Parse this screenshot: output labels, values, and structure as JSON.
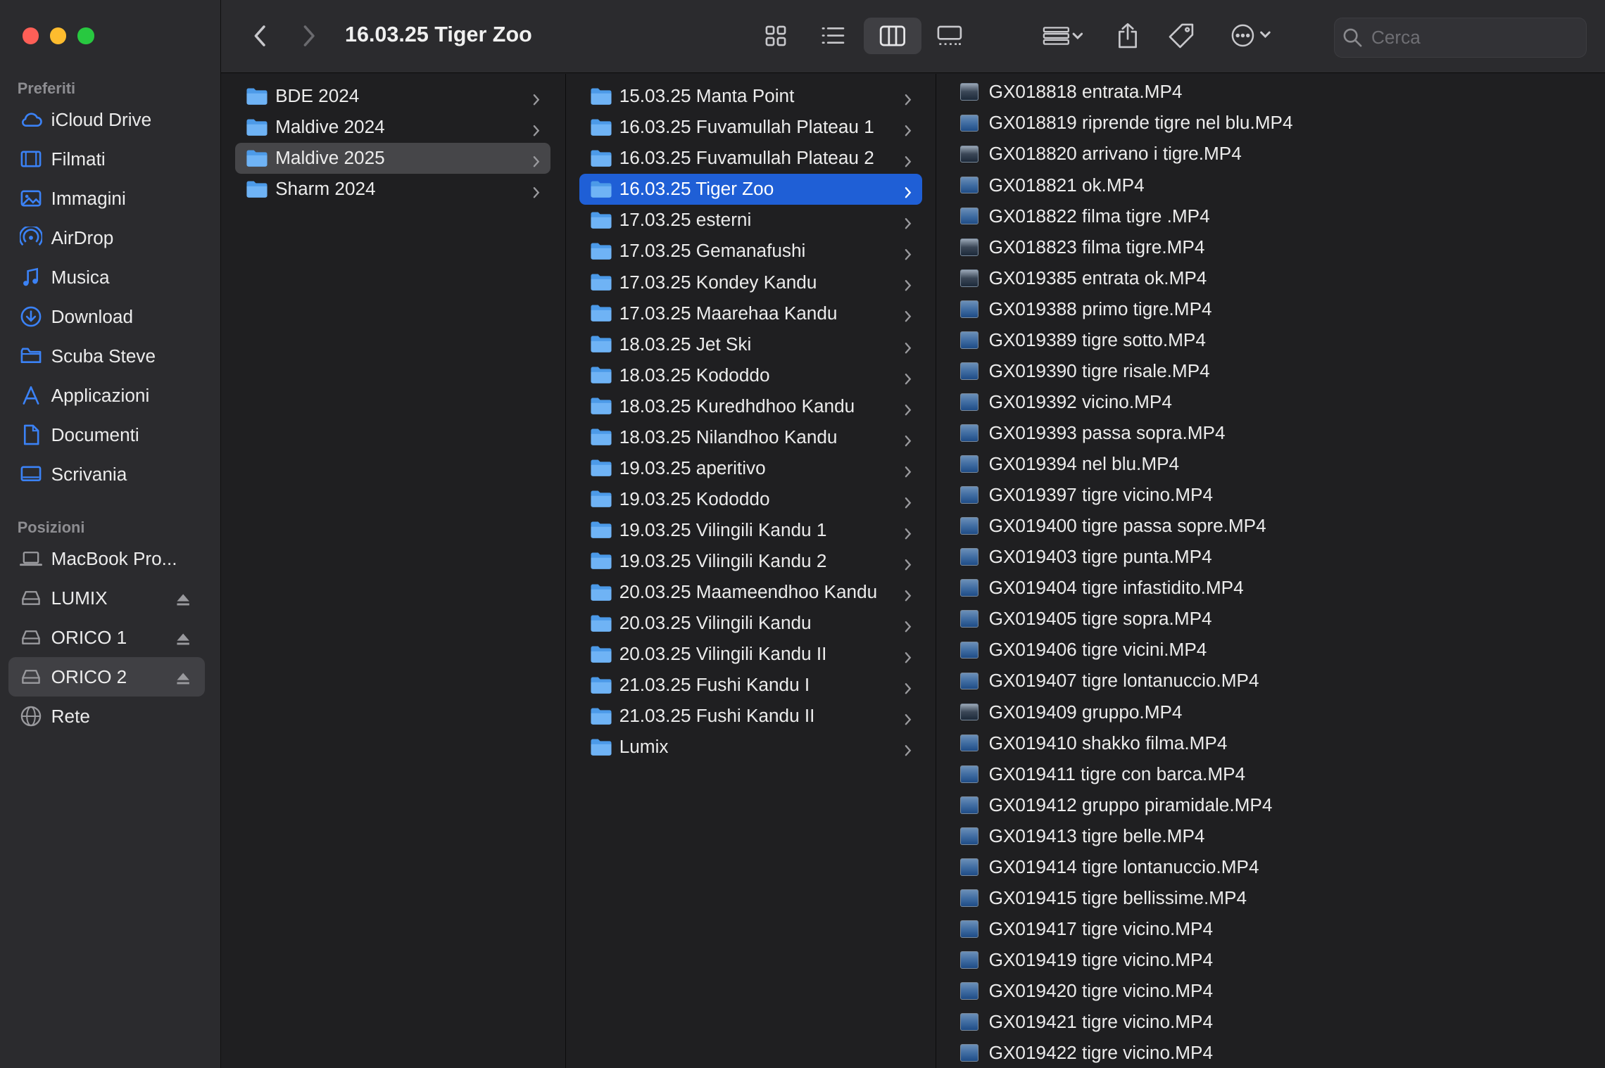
{
  "window": {
    "title": "16.03.25 Tiger Zoo"
  },
  "sidebar": {
    "favorites_header": "Preferiti",
    "favorites": [
      {
        "label": "iCloud Drive",
        "icon": "cloud-icon"
      },
      {
        "label": "Filmati",
        "icon": "film-icon"
      },
      {
        "label": "Immagini",
        "icon": "photo-icon"
      },
      {
        "label": "AirDrop",
        "icon": "airdrop-icon"
      },
      {
        "label": "Musica",
        "icon": "music-note-icon"
      },
      {
        "label": "Download",
        "icon": "download-icon"
      },
      {
        "label": "Scuba Steve",
        "icon": "folder-icon"
      },
      {
        "label": "Applicazioni",
        "icon": "applications-icon"
      },
      {
        "label": "Documenti",
        "icon": "document-icon"
      },
      {
        "label": "Scrivania",
        "icon": "desktop-icon"
      }
    ],
    "locations_header": "Posizioni",
    "locations": [
      {
        "label": "MacBook Pro...",
        "icon": "laptop-icon",
        "eject": false
      },
      {
        "label": "LUMIX",
        "icon": "drive-icon",
        "eject": true
      },
      {
        "label": "ORICO 1",
        "icon": "drive-icon",
        "eject": true
      },
      {
        "label": "ORICO 2",
        "icon": "drive-icon",
        "eject": true,
        "selected": true
      },
      {
        "label": "Rete",
        "icon": "network-icon",
        "eject": false
      }
    ]
  },
  "toolbar": {
    "search_placeholder": "Cerca"
  },
  "columns": {
    "col1": [
      "BDE 2024",
      "Maldive 2024",
      "Maldive 2025",
      "Sharm 2024"
    ],
    "col1_selected": 2,
    "col2": [
      "15.03.25 Manta Point",
      "16.03.25 Fuvamullah Plateau 1",
      "16.03.25 Fuvamullah Plateau 2",
      "16.03.25 Tiger Zoo",
      "17.03.25 esterni",
      "17.03.25 Gemanafushi",
      "17.03.25 Kondey Kandu",
      "17.03.25 Maarehaa Kandu",
      "18.03.25 Jet Ski",
      "18.03.25 Kododdo",
      "18.03.25 Kuredhdhoo Kandu",
      "18.03.25 Nilandhoo Kandu",
      "19.03.25 aperitivo",
      "19.03.25 Kododdo",
      "19.03.25 Vilingili Kandu 1",
      "19.03.25 Vilingili Kandu 2",
      "20.03.25 Maameendhoo Kandu",
      "20.03.25 Vilingili Kandu",
      "20.03.25 Vilingili Kandu II",
      "21.03.25 Fushi Kandu I",
      "21.03.25 Fushi Kandu II",
      "Lumix"
    ],
    "col2_selected": 3,
    "col3": [
      "GX018818 entrata.MP4",
      "GX018819 riprende tigre nel blu.MP4",
      "GX018820 arrivano i tigre.MP4",
      "GX018821 ok.MP4",
      "GX018822 filma tigre .MP4",
      "GX018823 filma tigre.MP4",
      "GX019385 entrata ok.MP4",
      "GX019388 primo tigre.MP4",
      "GX019389 tigre sotto.MP4",
      "GX019390 tigre risale.MP4",
      "GX019392 vicino.MP4",
      "GX019393 passa sopra.MP4",
      "GX019394 nel blu.MP4",
      "GX019397 tigre vicino.MP4",
      "GX019400 tigre passa sopre.MP4",
      "GX019403 tigre punta.MP4",
      "GX019404 tigre infastidito.MP4",
      "GX019405 tigre sopra.MP4",
      "GX019406 tigre vicini.MP4",
      "GX019407 tigre lontanuccio.MP4",
      "GX019409 gruppo.MP4",
      "GX019410 shakko filma.MP4",
      "GX019411 tigre con barca.MP4",
      "GX019412 gruppo piramidale.MP4",
      "GX019413 tigre belle.MP4",
      "GX019414 tigre lontanuccio.MP4",
      "GX019415 tigre bellissime.MP4",
      "GX019417 tigre vicino.MP4",
      "GX019419 tigre vicino.MP4",
      "GX019420 tigre vicino.MP4",
      "GX019421 tigre vicino.MP4",
      "GX019422 tigre vicino.MP4"
    ]
  },
  "colors": {
    "selection_blue": "#1f5fd6",
    "accent": "#3b82f6",
    "folder": "#5aa9f2"
  }
}
